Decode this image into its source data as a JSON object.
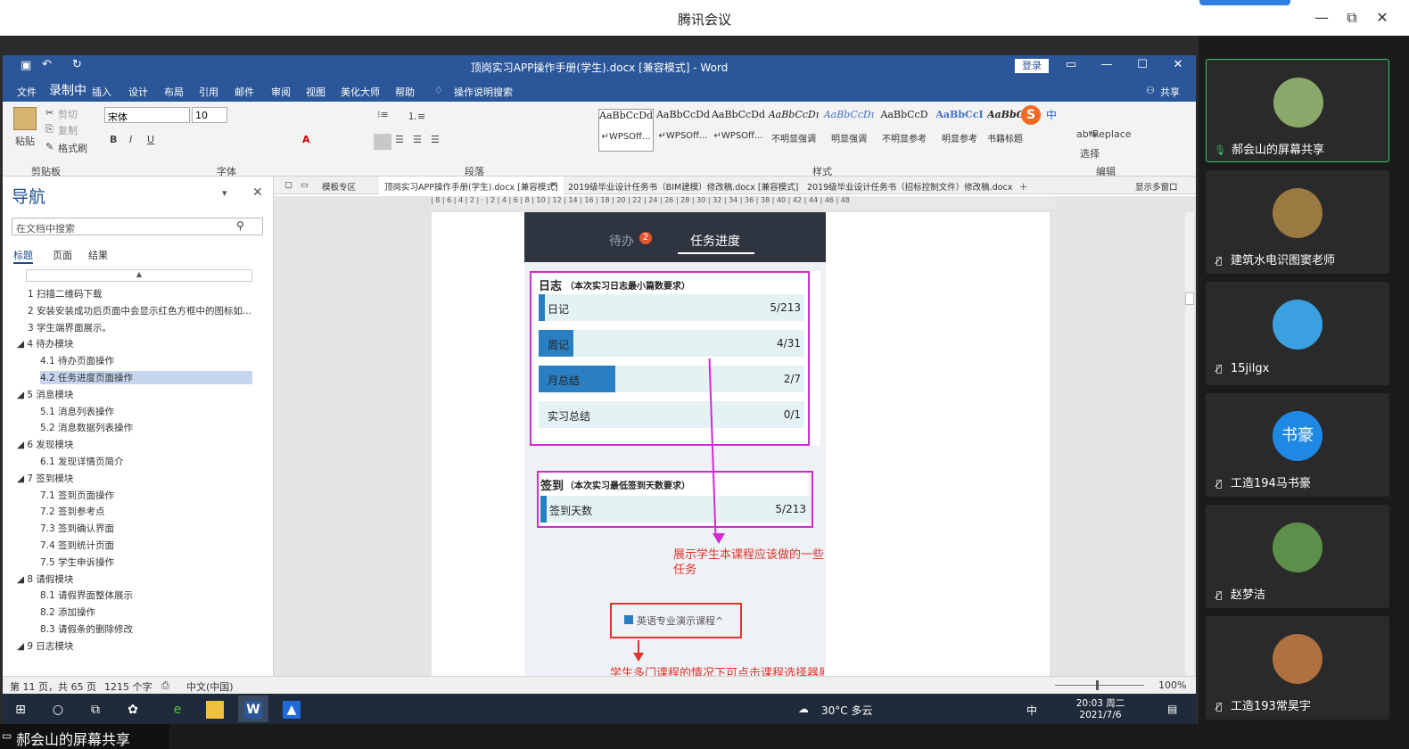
{
  "meeting": {
    "title": "腾讯会议",
    "controls": [
      "—",
      "⧉",
      "✕"
    ]
  },
  "word": {
    "title": "顶岗实习APP操作手册(学生).docx [兼容模式] - Word",
    "login": "登录",
    "tabs": [
      "文件",
      "录制中",
      "插入",
      "设计",
      "布局",
      "引用",
      "邮件",
      "审阅",
      "视图",
      "美化大师",
      "帮助",
      "操作说明搜索"
    ],
    "share": "共享",
    "clipboard": {
      "paste": "粘贴",
      "cut": "剪切",
      "copy": "复制",
      "format_painter": "格式刷",
      "group": "剪贴板"
    },
    "font": {
      "name": "宋体",
      "size": "10",
      "group": "字体"
    },
    "paragraph_group": "段落",
    "styles": {
      "items": [
        {
          "sample": "AaBbCcDd",
          "name": "↵WPSOff..."
        },
        {
          "sample": "AaBbCcDd",
          "name": "↵WPSOff..."
        },
        {
          "sample": "AaBbCcDd",
          "name": "↵WPSOff..."
        },
        {
          "sample": "AaBbCcDı",
          "name": "不明显强调"
        },
        {
          "sample": "AaBbCcDı",
          "name": "明显强调"
        },
        {
          "sample": "AaBbCcD",
          "name": "不明显参考"
        },
        {
          "sample": "AaBbCcI",
          "name": "明显参考"
        },
        {
          "sample": "AaBbCcI",
          "name": "书籍标题"
        }
      ],
      "group": "样式"
    },
    "editing": {
      "replace": "Replace",
      "select": "选择",
      "group": "编辑"
    }
  },
  "nav": {
    "title": "导航",
    "search_placeholder": "在文档中搜索",
    "tabs": [
      "标题",
      "页面",
      "结果"
    ],
    "items": [
      {
        "text": "1 扫描二维码下载",
        "level": 1
      },
      {
        "text": "2 安装安装成功后页面中会显示红色方框中的图标如...",
        "level": 1
      },
      {
        "text": "3 学生端界面展示。",
        "level": 1
      },
      {
        "text": "◢ 4 待办模块",
        "level": 0
      },
      {
        "text": "4.1 待办页面操作",
        "level": 2
      },
      {
        "text": "4.2 任务进度页面操作",
        "level": 2,
        "selected": true
      },
      {
        "text": "◢ 5 消息模块",
        "level": 0
      },
      {
        "text": "5.1 消息列表操作",
        "level": 2
      },
      {
        "text": "5.2 消息数据列表操作",
        "level": 2
      },
      {
        "text": "◢ 6 发现模块",
        "level": 0
      },
      {
        "text": "6.1 发现详情页简介",
        "level": 2
      },
      {
        "text": "◢ 7 签到模块",
        "level": 0
      },
      {
        "text": "7.1 签到页面操作",
        "level": 2
      },
      {
        "text": "7.2 签到参考点",
        "level": 2
      },
      {
        "text": "7.3 签到确认界面",
        "level": 2
      },
      {
        "text": "7.4 签到统计页面",
        "level": 2
      },
      {
        "text": "7.5 学生申诉操作",
        "level": 2
      },
      {
        "text": "◢ 8 请假模块",
        "level": 0
      },
      {
        "text": "8.1 请假界面整体展示",
        "level": 2
      },
      {
        "text": "8.2 添加操作",
        "level": 2
      },
      {
        "text": "8.3 请假条的删除修改",
        "level": 2
      },
      {
        "text": "◢ 9 日志模块",
        "level": 0
      }
    ]
  },
  "doc_tabs": [
    "模板专区",
    "顶岗实习APP操作手册(学生).docx [兼容模式]",
    "2019级毕业设计任务书（BIM建模）修改稿.docx [兼容模式]",
    "2019级毕业设计任务书（招标控制文件）修改稿.docx",
    "显示多窗口"
  ],
  "phone": {
    "tab_todo": "待办",
    "badge": "2",
    "tab_progress": "任务进度",
    "log_title": "日志",
    "log_subtitle": "（本次实习日志最小篇数要求）",
    "rows": [
      {
        "label": "日记",
        "value": "5/213",
        "progress": 0.023
      },
      {
        "label": "周记",
        "value": "4/31",
        "progress": 0.13
      },
      {
        "label": "月总结",
        "value": "2/7",
        "progress": 0.29
      },
      {
        "label": "实习总结",
        "value": "0/1",
        "progress": 0.0
      }
    ],
    "sign_title": "签到",
    "sign_subtitle": "（本次实习最低签到天数要求）",
    "sign_row": {
      "label": "签到天数",
      "value": "5/213",
      "progress": 0.023
    },
    "annotation1": "展示学生本课程应该做的一些任务",
    "course_btn": "英语专业演示课程^",
    "annotation2": "学生多门课程的情况下可点击课程选择器展示不"
  },
  "status": {
    "page": "第 11 页，共 65 页",
    "words": "1215 个字",
    "lang": "中文(中国)",
    "zoom": "100%"
  },
  "taskbar": {
    "weather": "30°C 多云",
    "time": "20:03 周二",
    "date": "2021/7/6",
    "ime": "中"
  },
  "share_label": "郝会山的屏幕共享",
  "participants": [
    {
      "name": "郝会山的屏幕共享",
      "avatar_color": "#8aa86a",
      "sharing": true
    },
    {
      "name": "建筑水电识图窦老师",
      "avatar_color": "#9a7a40",
      "muted": true
    },
    {
      "name": "15jilgx",
      "avatar_color": "#3aa0e0",
      "muted": true
    },
    {
      "name": "工造194马书豪",
      "avatar_color": "#1e88e5",
      "initials": "书豪",
      "muted": true
    },
    {
      "name": "赵梦洁",
      "avatar_color": "#5e8f4a",
      "muted": true
    },
    {
      "name": "工造193常昊宇",
      "avatar_color": "#b07040",
      "muted": true
    }
  ],
  "colors": {
    "word_blue": "#2b579a",
    "highlight": "#d42ad1",
    "bar_blue": "#2a7fc2",
    "annotation_red": "#e0352b"
  }
}
